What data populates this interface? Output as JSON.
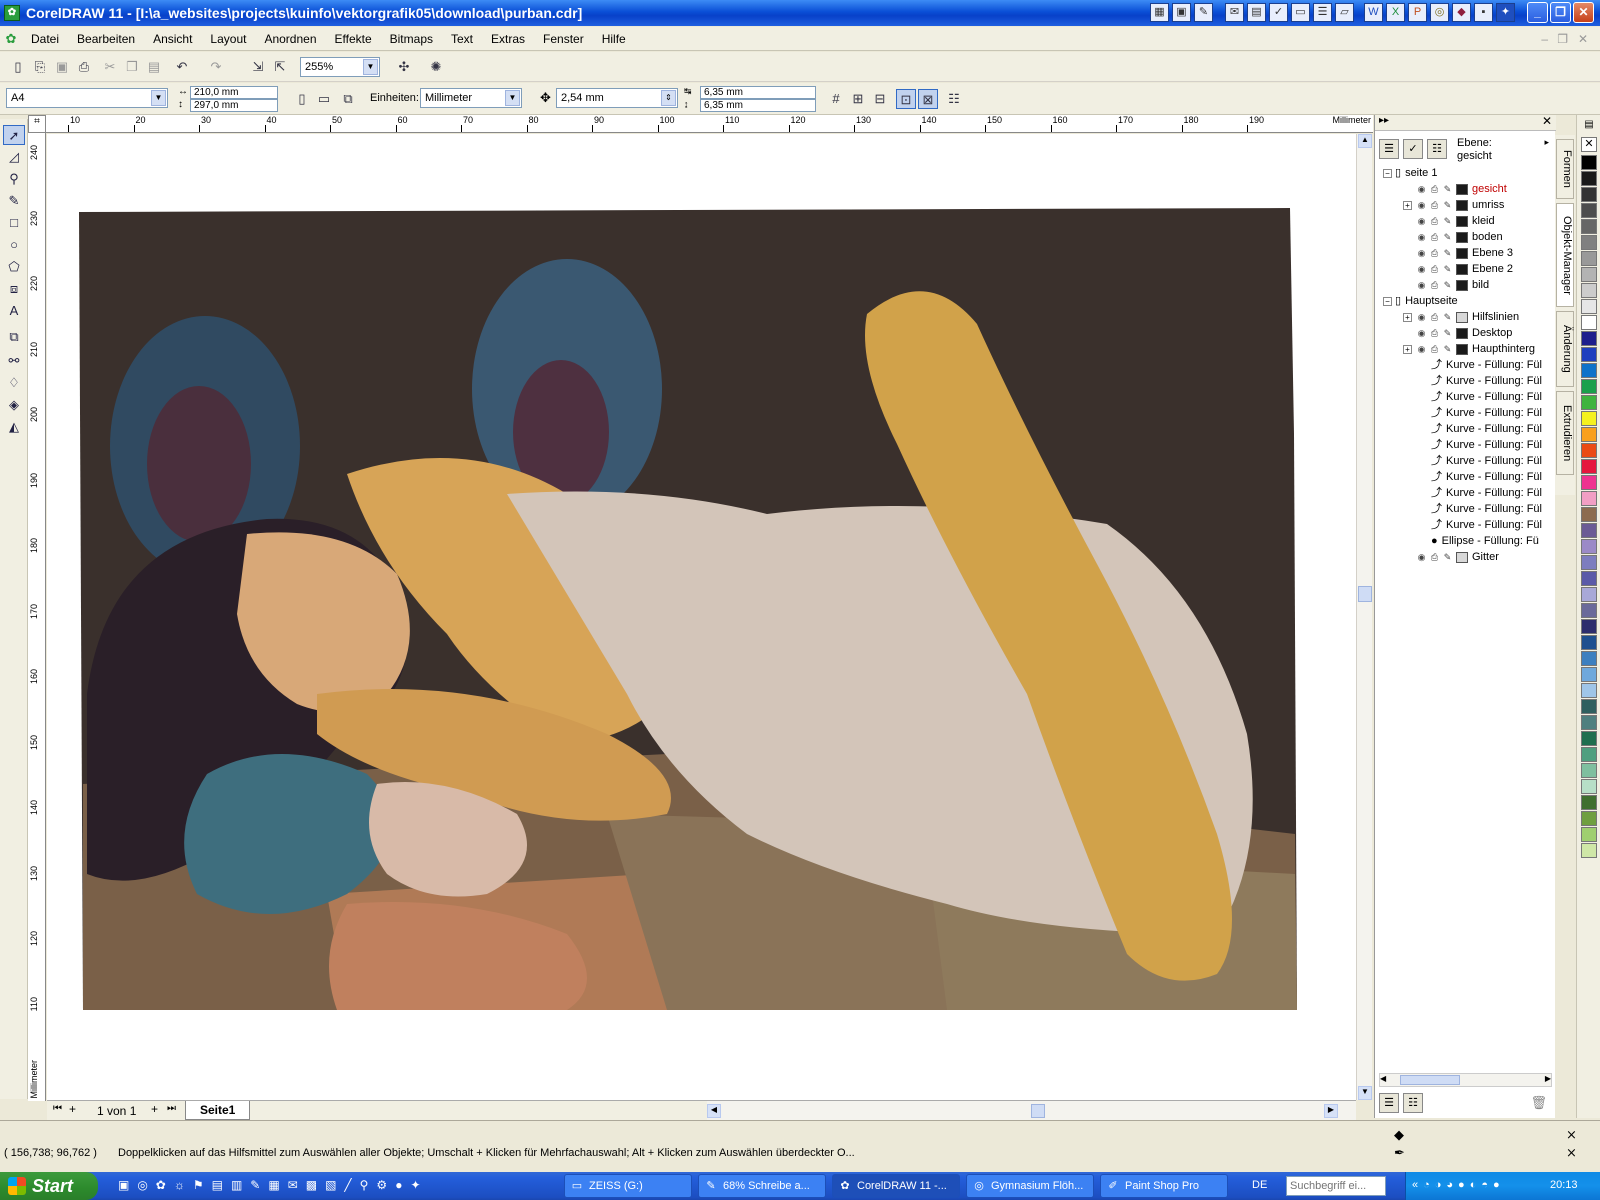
{
  "window": {
    "title": "CorelDRAW 11 - [I:\\a_websites\\projects\\kuinfo\\vektorgrafik05\\download\\purban.cdr]"
  },
  "menu": [
    "Datei",
    "Bearbeiten",
    "Ansicht",
    "Layout",
    "Anordnen",
    "Effekte",
    "Bitmaps",
    "Text",
    "Extras",
    "Fenster",
    "Hilfe"
  ],
  "toolbar": {
    "zoom": "255%"
  },
  "property_bar": {
    "page_size": "A4",
    "width": "210,0 mm",
    "height": "297,0 mm",
    "units_label": "Einheiten:",
    "units": "Millimeter",
    "nudge": "2,54 mm",
    "dup_x": "6,35 mm",
    "dup_y": "6,35 mm"
  },
  "ruler": {
    "unit": "Millimeter",
    "h_ticks": [
      "10",
      "20",
      "30",
      "40",
      "50",
      "60",
      "70",
      "80",
      "90",
      "100",
      "110",
      "120",
      "130",
      "140",
      "150",
      "160",
      "170",
      "180",
      "190"
    ],
    "v_ticks": [
      "240",
      "230",
      "220",
      "210",
      "200",
      "190",
      "180",
      "170",
      "160",
      "150",
      "140",
      "130",
      "120",
      "110"
    ]
  },
  "page_nav": {
    "count": "1 von 1",
    "tab": "Seite1"
  },
  "docker": {
    "layer_label": "Ebene:",
    "layer_name": "gesicht",
    "tabs": [
      "Formen",
      "Objekt-Manager",
      "Änderung",
      "Extrudieren"
    ],
    "tree": [
      {
        "label": "seite 1",
        "level": 0,
        "type": "page"
      },
      {
        "label": "gesicht",
        "level": 1,
        "type": "layer",
        "active": true
      },
      {
        "label": "umriss",
        "level": 1,
        "type": "layer",
        "expandable": true
      },
      {
        "label": "kleid",
        "level": 1,
        "type": "layer"
      },
      {
        "label": "boden",
        "level": 1,
        "type": "layer"
      },
      {
        "label": "Ebene 3",
        "level": 1,
        "type": "layer"
      },
      {
        "label": "Ebene 2",
        "level": 1,
        "type": "layer"
      },
      {
        "label": "bild",
        "level": 1,
        "type": "layer"
      },
      {
        "label": "Hauptseite",
        "level": 0,
        "type": "page"
      },
      {
        "label": "Hilfslinien",
        "level": 1,
        "type": "layer",
        "expandable": true,
        "light": true
      },
      {
        "label": "Desktop",
        "level": 1,
        "type": "layer"
      },
      {
        "label": "Haupthinterg",
        "level": 1,
        "type": "layer",
        "expandable": true
      },
      {
        "label": "Kurve - Füllung: Fül",
        "level": 2,
        "type": "curve"
      },
      {
        "label": "Kurve - Füllung: Fül",
        "level": 2,
        "type": "curve"
      },
      {
        "label": "Kurve - Füllung: Fül",
        "level": 2,
        "type": "curve"
      },
      {
        "label": "Kurve - Füllung: Fül",
        "level": 2,
        "type": "curve"
      },
      {
        "label": "Kurve - Füllung: Fül",
        "level": 2,
        "type": "curve"
      },
      {
        "label": "Kurve - Füllung: Fül",
        "level": 2,
        "type": "curve"
      },
      {
        "label": "Kurve - Füllung: Fül",
        "level": 2,
        "type": "curve"
      },
      {
        "label": "Kurve - Füllung: Fül",
        "level": 2,
        "type": "curve"
      },
      {
        "label": "Kurve - Füllung: Fül",
        "level": 2,
        "type": "curve"
      },
      {
        "label": "Kurve - Füllung: Fül",
        "level": 2,
        "type": "curve"
      },
      {
        "label": "Kurve - Füllung: Fül",
        "level": 2,
        "type": "curve"
      },
      {
        "label": "Ellipse - Füllung: Fü",
        "level": 2,
        "type": "ellipse"
      },
      {
        "label": "Gitter",
        "level": 1,
        "type": "layer",
        "light": true
      }
    ]
  },
  "palette": [
    "#000000",
    "#1a1a1a",
    "#333333",
    "#4d4d4d",
    "#666666",
    "#808080",
    "#999999",
    "#b3b3b3",
    "#cccccc",
    "#e6e6e6",
    "#ffffff",
    "#1e1e8c",
    "#1f3fbf",
    "#0f72c9",
    "#1aa04c",
    "#3fb43f",
    "#f4f11f",
    "#f8a01c",
    "#ea4b15",
    "#e5173d",
    "#ee3390",
    "#f19ec4",
    "#8c6b4f",
    "#6b5b95",
    "#9b8ac7",
    "#7d7dbf",
    "#5a5aa8",
    "#a8a8d8",
    "#6a6a9a",
    "#2d2d6d",
    "#1f4f8f",
    "#3d7fbf",
    "#6fa8dc",
    "#9fc5e8",
    "#2f5f5f",
    "#4f7f7f",
    "#1f6f4f",
    "#4f9f7f",
    "#7fbf9f",
    "#b7dfc7",
    "#3f6f2f",
    "#6f9f3f",
    "#9fcf6f",
    "#cfe7a7"
  ],
  "status": {
    "coords": "( 156,738; 96,762 )",
    "hint": "Doppelklicken auf das Hilfsmittel zum Auswählen aller Objekte; Umschalt + Klicken für Mehrfachauswahl; Alt + Klicken zum Auswählen überdeckter O..."
  },
  "taskbar": {
    "start": "Start",
    "tasks": [
      "ZEISS (G:)",
      "68% Schreibe a...",
      "CorelDRAW 11 -...",
      "Gymnasium Flöh...",
      "Paint Shop Pro"
    ],
    "lang": "DE",
    "search_placeholder": "Suchbegriff ei...",
    "clock": "20:13"
  }
}
